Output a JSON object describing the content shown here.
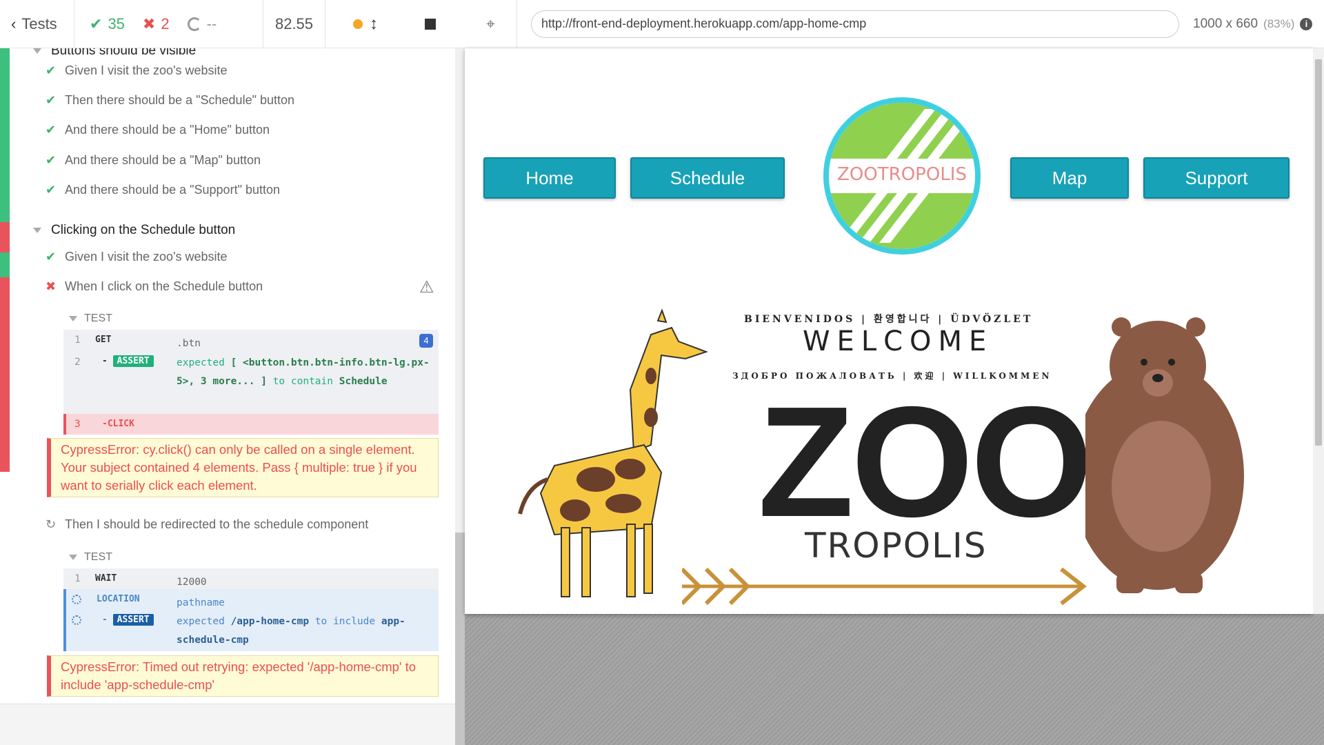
{
  "reporter": {
    "header": {
      "tests_label": "Tests",
      "passed": "35",
      "failed": "2",
      "pending": "--",
      "duration": "82.55"
    },
    "suites": [
      {
        "title": "Buttons should be visible",
        "steps": [
          {
            "status": "passed",
            "text": "Given I visit the zoo's website"
          },
          {
            "status": "passed",
            "text": "Then there should be a \"Schedule\" button"
          },
          {
            "status": "passed",
            "text": "And there should be a \"Home\" button"
          },
          {
            "status": "passed",
            "text": "And there should be a \"Map\" button"
          },
          {
            "status": "passed",
            "text": "And there should be a \"Support\" button"
          }
        ]
      },
      {
        "title": "Clicking on the Schedule button",
        "steps": [
          {
            "status": "passed",
            "text": "Given I visit the zoo's website"
          },
          {
            "status": "failed",
            "text": "When I click on the Schedule button"
          },
          {
            "status": "retry",
            "text": "Then I should be redirected to the schedule component"
          }
        ]
      }
    ],
    "test_label": "TEST",
    "block1": {
      "cmd1": {
        "num": "1",
        "name": "GET",
        "msg": ".btn",
        "count": "4"
      },
      "cmd2": {
        "num": "2",
        "name": "ASSERT",
        "prefix": "-",
        "msg_expected": "expected",
        "msg_subject": "[ <button.btn.btn-info.btn-lg.px-5>, 3 more... ]",
        "msg_verb": "to contain",
        "msg_value": "Schedule"
      },
      "cmd3": {
        "num": "3",
        "name": "-CLICK"
      }
    },
    "error1": "CypressError: cy.click() can only be called on a single element. Your subject contained 4 elements. Pass { multiple: true } if you want to serially click each element.",
    "block2": {
      "cmd1": {
        "num": "1",
        "name": "WAIT",
        "msg": "12000"
      },
      "cmd2": {
        "name": "LOCATION",
        "msg": "pathname"
      },
      "cmd3": {
        "name": "ASSERT",
        "prefix": "-",
        "msg_expected": "expected",
        "msg_subject": "/app-home-cmp",
        "msg_verb": "to include",
        "msg_value": "app-schedule-cmp"
      }
    },
    "error2": "CypressError: Timed out retrying: expected '/app-home-cmp' to include 'app-schedule-cmp'"
  },
  "app_header": {
    "url": "http://front-end-deployment.herokuapp.com/app-home-cmp",
    "viewport": "1000 x 660",
    "zoom": "(83%)"
  },
  "site": {
    "nav": {
      "home": "Home",
      "schedule": "Schedule",
      "map": "Map",
      "support": "Support"
    },
    "logo_text": "ZOOTROPOLIS",
    "welcome_top": "BIENVENIDOS | 환영합니다 | ÜDVÖZLET",
    "welcome": "WELCOME",
    "welcome_bottom": "ЗДОБРО ПОЖАЛОВАТЬ | 欢迎 | WILLKOMMEN",
    "zoo": "ZOO",
    "tropolis": "TROPOLIS"
  },
  "colors": {
    "pass": "#3db36a",
    "fail": "#e94f4f",
    "nav_button": "#17a2b8",
    "logo_ring": "#3fd0e0",
    "logo_green": "#8fd14f"
  }
}
